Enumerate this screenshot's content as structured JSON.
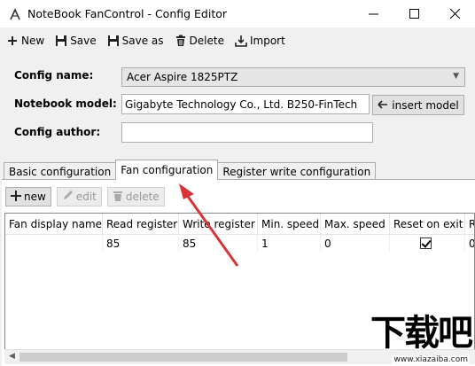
{
  "window": {
    "title": "NoteBook FanControl - Config Editor"
  },
  "toolbar": {
    "new": "New",
    "save": "Save",
    "save_as": "Save as",
    "delete": "Delete",
    "import": "Import"
  },
  "form": {
    "config_name_label": "Config name:",
    "config_name_value": "Acer Aspire 1825PTZ",
    "notebook_model_label": "Notebook model:",
    "notebook_model_value": "Gigabyte Technology Co., Ltd. B250-FinTech",
    "insert_model": "insert model",
    "config_author_label": "Config author:",
    "config_author_value": ""
  },
  "tabs": [
    "Basic configuration",
    "Fan configuration",
    "Register write configuration"
  ],
  "active_tab": "Fan configuration",
  "panel_toolbar": {
    "new": "new",
    "edit": "edit",
    "delete": "delete"
  },
  "grid": {
    "columns": [
      "Fan display name",
      "Read register",
      "Write register",
      "Min. speed",
      "Max. speed",
      "Reset on exit",
      "R"
    ],
    "rows": [
      {
        "name": "",
        "read": "85",
        "write": "85",
        "min": "1",
        "max": "0",
        "reset": true
      }
    ]
  },
  "watermark": {
    "big": "下载吧",
    "url": "www.xiazaiba.com"
  },
  "colors": {
    "annotation_arrow": "#d9333a"
  }
}
